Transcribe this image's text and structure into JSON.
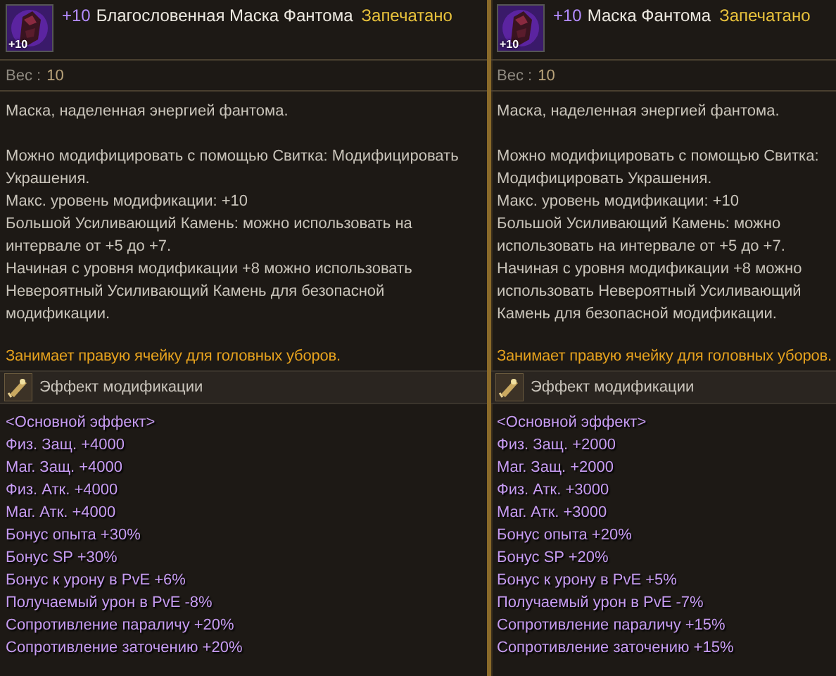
{
  "panels": [
    {
      "enchant": "+10",
      "name": "Благословенная Маска Фантома",
      "status": "Запечатано",
      "icon_badge": "+10",
      "weight_label": "Вес :",
      "weight_value": "10",
      "description": [
        [
          "Маска, наделенная энергией фантома."
        ],
        [
          "Можно модифицировать с помощью Свитка: Модифицировать",
          "Украшения.",
          "Макс. уровень модификации: +10",
          "Большой Усиливающий Камень: можно использовать на",
          "интервале от +5 до +7.",
          "Начиная с уровня модификации +8 можно использовать",
          "Невероятный Усиливающий Камень для безопасной",
          "модификации."
        ]
      ],
      "slot_note": "Занимает правую ячейку для головных уборов.",
      "section_title": "Эффект модификации",
      "effects": [
        "<Основной эффект>",
        "Физ. Защ. +4000",
        "Маг. Защ. +4000",
        "Физ. Атк. +4000",
        "Маг. Атк. +4000",
        "Бонус опыта +30%",
        "Бонус SP +30%",
        "Бонус к урону в PvE +6%",
        "Получаемый урон в PvE -8%",
        "Сопротивление параличу +20%",
        "Сопротивление заточению +20%"
      ]
    },
    {
      "enchant": "+10",
      "name": "Маска Фантома",
      "status": "Запечатано",
      "icon_badge": "+10",
      "weight_label": "Вес :",
      "weight_value": "10",
      "description": [
        [
          "Маска, наделенная энергией фантома."
        ],
        [
          "Можно модифицировать с помощью Свитка:",
          "Модифицировать Украшения.",
          "Макс. уровень модификации: +10",
          "Большой Усиливающий Камень: можно",
          "использовать на интервале от +5 до +7.",
          "Начиная с уровня модификации +8 можно",
          "использовать Невероятный Усиливающий",
          "Камень для безопасной модификации."
        ]
      ],
      "slot_note": "Занимает правую ячейку для головных уборов.",
      "section_title": "Эффект модификации",
      "effects": [
        "<Основной эффект>",
        "Физ. Защ. +2000",
        "Маг. Защ. +2000",
        "Физ. Атк. +3000",
        "Маг. Атк. +3000",
        "Бонус опыта +20%",
        "Бонус SP +20%",
        "Бонус к урону в PvE +5%",
        "Получаемый урон в PvE -7%",
        "Сопротивление параличу +15%",
        "Сопротивление заточению +15%"
      ]
    }
  ]
}
